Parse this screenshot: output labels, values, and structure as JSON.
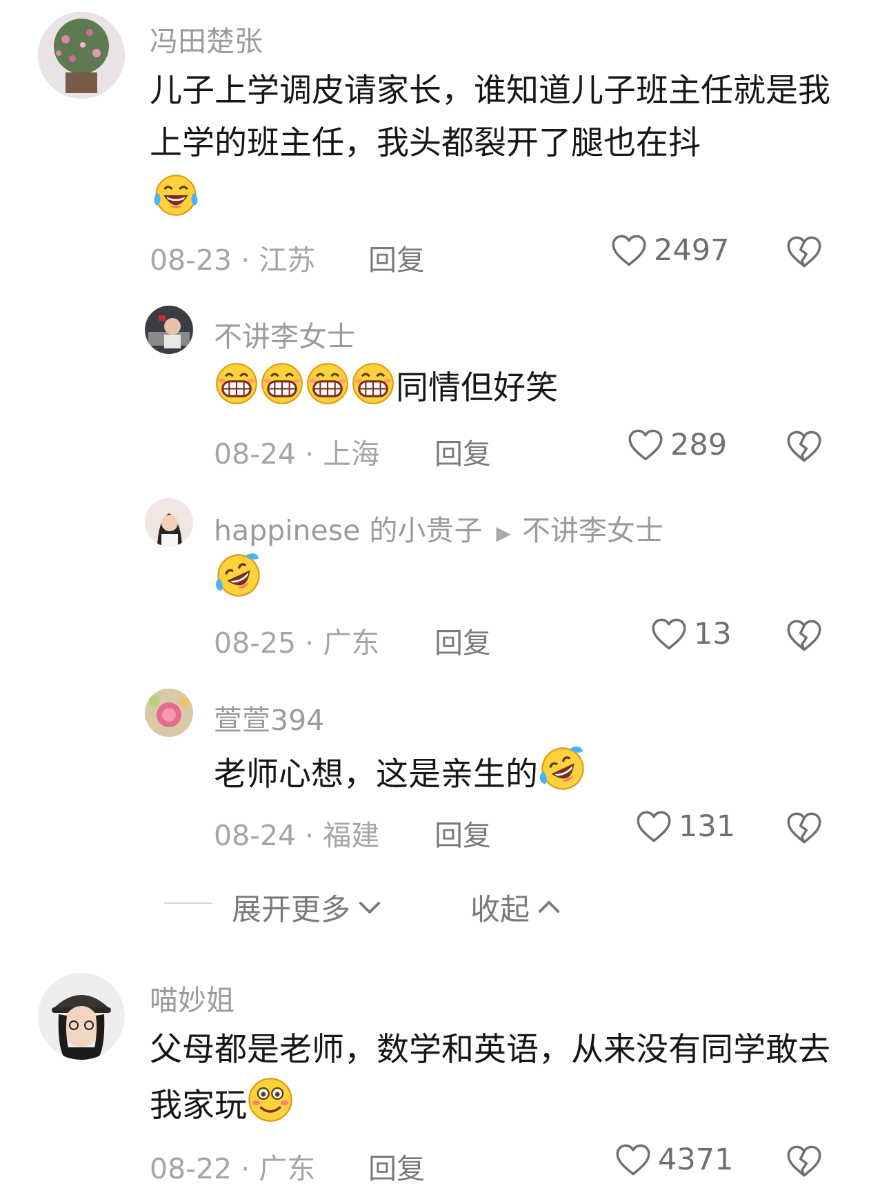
{
  "comments": [
    {
      "user": "冯田楚张",
      "text": "儿子上学调皮请家长，谁知道儿子班主任就是我上学的班主任，我头都裂开了腿也在抖",
      "date": "08-23",
      "location": "江苏",
      "reply_label": "回复",
      "likes": "2497",
      "replies": [
        {
          "user": "不讲李女士",
          "text": "同情但好笑",
          "date": "08-24",
          "location": "上海",
          "reply_label": "回复",
          "likes": "289"
        },
        {
          "user": "happinese 的小贵子",
          "reply_to": "不讲李女士",
          "text": "",
          "date": "08-25",
          "location": "广东",
          "reply_label": "回复",
          "likes": "13"
        },
        {
          "user": "萱萱394",
          "text": "老师心想，这是亲生的",
          "date": "08-24",
          "location": "福建",
          "reply_label": "回复",
          "likes": "131"
        }
      ]
    },
    {
      "user": "喵妙姐",
      "text": "父母都是老师，数学和英语，从来没有同学敢去我家玩",
      "date": "08-22",
      "location": "广东",
      "reply_label": "回复",
      "likes": "4371"
    }
  ],
  "controls": {
    "expand_label": "展开更多",
    "collapse_label": "收起"
  },
  "separator": " · ",
  "icons": [
    "heart-outline-icon",
    "broken-heart-icon",
    "chevron-down-icon",
    "chevron-up-icon",
    "laugh-cry-emoji",
    "grin-emoji",
    "rofl-emoji",
    "shy-smile-emoji"
  ]
}
